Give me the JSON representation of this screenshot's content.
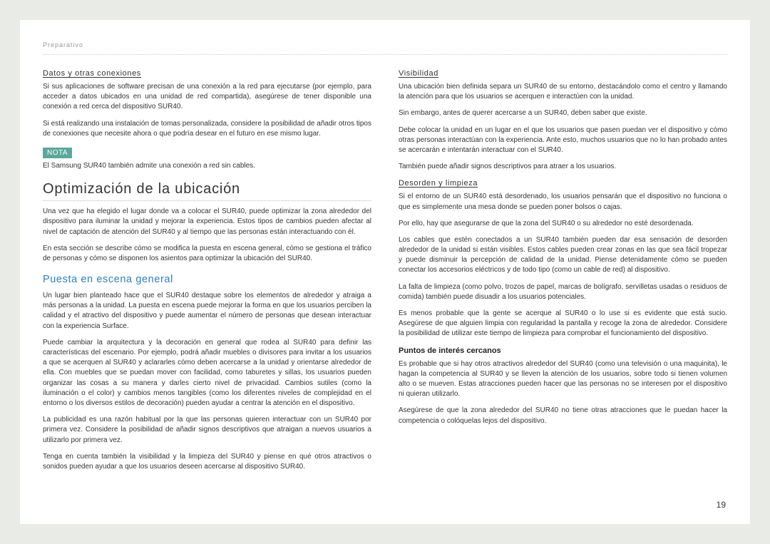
{
  "header": "Preparativo",
  "pageNumber": "19",
  "left": {
    "h_datos": "Datos y otras conexiones",
    "p1": "Si sus aplicaciones de software precisan de una conexión a la red para ejecutarse (por ejemplo, para acceder a datos ubicados en una unidad de red compartida), asegúrese de tener disponible una conexión a red cerca del dispositivo SUR40.",
    "p2": "Si está realizando una instalación de tomas personalizada, considere la posibilidad de añadir otros tipos de conexiones que necesite ahora o que podría desear en el futuro en ese mismo lugar.",
    "nota_label": "NOTA",
    "nota_text": "El Samsung SUR40 también admite una conexión a red sin cables.",
    "h1": "Optimización de la ubicación",
    "p3": "Una vez que ha elegido el lugar donde va a colocar el SUR40, puede optimizar la zona alrededor del dispositivo para iluminar la unidad y mejorar la experiencia. Estos tipos de cambios pueden afectar al nivel de captación de atención del SUR40 y al tiempo que las personas están interactuando con él.",
    "p4": "En esta sección se describe cómo se modifica la puesta en escena general, cómo se gestiona el tráfico de personas y cómo se disponen los asientos para optimizar la ubicación del SUR40.",
    "h2": "Puesta en escena general",
    "p5": "Un lugar bien planteado hace que el SUR40 destaque sobre los elementos de alrededor y atraiga a más personas a la unidad. La puesta en escena puede mejorar la forma en que los usuarios perciben la calidad y el atractivo del dispositivo y puede aumentar el número de personas que desean interactuar con la experiencia Surface.",
    "p6": "Puede cambiar la arquitectura y la decoración en general que rodea al SUR40 para definir las características del escenario. Por ejemplo, podrá añadir muebles o divisores para invitar a los usuarios a que se acerquen al SUR40 y aclararles cómo deben acercarse a la unidad y orientarse alrededor de ella.  Con muebles que se puedan mover con facilidad, como taburetes y sillas, los usuarios pueden organizar las cosas a su manera y darles cierto nivel de privacidad. Cambios sutiles (como la iluminación o el color) y cambios menos tangibles (como los diferentes niveles de complejidad en el entorno o los diversos estilos de decoración) pueden ayudar a centrar la atención en el dispositivo.",
    "p7": "La publicidad es una razón habitual por la que las personas quieren interactuar con un SUR40 por primera vez. Considere la posibilidad de añadir signos descriptivos que atraigan a nuevos usuarios a utilizarlo por primera vez.",
    "p8": "Tenga en cuenta también la visibilidad y la limpieza del SUR40 y piense en qué otros atractivos o sonidos pueden ayudar a que los usuarios deseen acercarse al dispositivo SUR40."
  },
  "right": {
    "h_vis": "Visibilidad",
    "v1": "Una ubicación bien definida separa un SUR40 de su entorno, destacándolo como el centro y llamando la atención para que los usuarios se acerquen e interactúen con la unidad.",
    "v2": "Sin embargo, antes de querer acercarse a un SUR40, deben saber que existe.",
    "v3": "Debe colocar la unidad en un lugar en el que los usuarios que pasen puedan ver el dispositivo y cómo otras personas interactúan con la experiencia. Ante esto, muchos usuarios que no lo han probado antes se acercarán e intentarán interactuar con el SUR40.",
    "v4": "También puede añadir signos descriptivos para atraer a los usuarios.",
    "h_des": "Desorden y limpieza",
    "d1": "Si el entorno de un SUR40 está desordenado, los usuarios pensarán que el dispositivo no funciona o que es simplemente una mesa donde se pueden poner bolsos o cajas.",
    "d2": "Por ello, hay que asegurarse de que la zona del SUR40 o su alrededor no esté desordenada.",
    "d3": "Los cables que estén conectados a un SUR40 también pueden dar esa sensación de desorden alrededor de la unidad si están visibles. Estos cables pueden crear zonas en las que sea fácil tropezar y puede disminuir la percepción de calidad de la unidad. Piense detenidamente cómo se pueden conectar los accesorios eléctricos y de todo tipo (como un cable de red) al dispositivo.",
    "d4": "La falta de limpieza (como polvo, trozos de papel, marcas de bolígrafo, servilletas usadas o residuos de comida) también puede disuadir a los usuarios potenciales.",
    "d5": "Es menos probable que la gente se acerque al SUR40 o lo use si es evidente que está sucio. Asegúrese de que alguien limpia con regularidad la pantalla y recoge la zona de alrededor. Considere la posibilidad de utilizar este tiempo de limpieza para comprobar el funcionamiento del dispositivo.",
    "h_puntos": "Puntos de interés cercanos",
    "pi1": "Es probable que si hay otros atractivos alrededor del SUR40 (como una televisión o una maquinita), le hagan la competencia al SUR40 y se lleven la atención de los usuarios, sobre todo si tienen volumen alto o se mueven. Estas atracciones pueden hacer que las personas no se interesen por el dispositivo ni quieran utilizarlo.",
    "pi2": "Asegúrese de que la zona alrededor del SUR40 no tiene otras atracciones que le puedan hacer la competencia o colóquelas lejos del dispositivo."
  }
}
